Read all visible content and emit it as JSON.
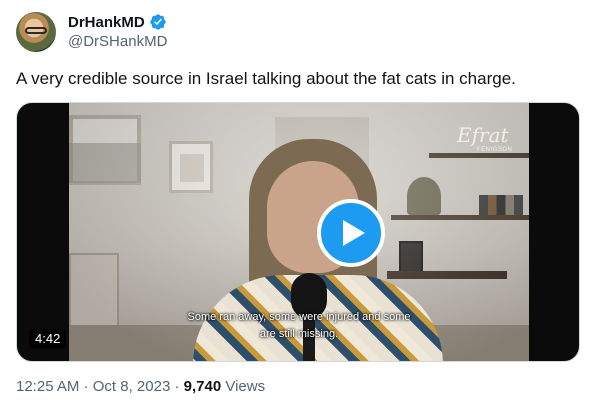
{
  "author": {
    "display_name": "DrHankMD",
    "handle": "@DrSHankMD",
    "verified": true,
    "verified_color": "#1d9bf0"
  },
  "tweet": {
    "text": "A very credible source in Israel talking about the fat cats in charge."
  },
  "media": {
    "type": "video",
    "duration": "4:42",
    "caption_line1": "Some ran away, some were injured and some",
    "caption_line2": "are still missing.",
    "watermark": "Efrat",
    "watermark_sub": "FENIGSON",
    "play_color": "#1d9bf0"
  },
  "meta": {
    "time": "12:25 AM",
    "separator1": " · ",
    "date": "Oct 8, 2023",
    "separator2": " · ",
    "views_count": "9,740",
    "views_label": " Views"
  },
  "icons": [
    "verified-badge-icon",
    "play-icon",
    "avatar"
  ]
}
